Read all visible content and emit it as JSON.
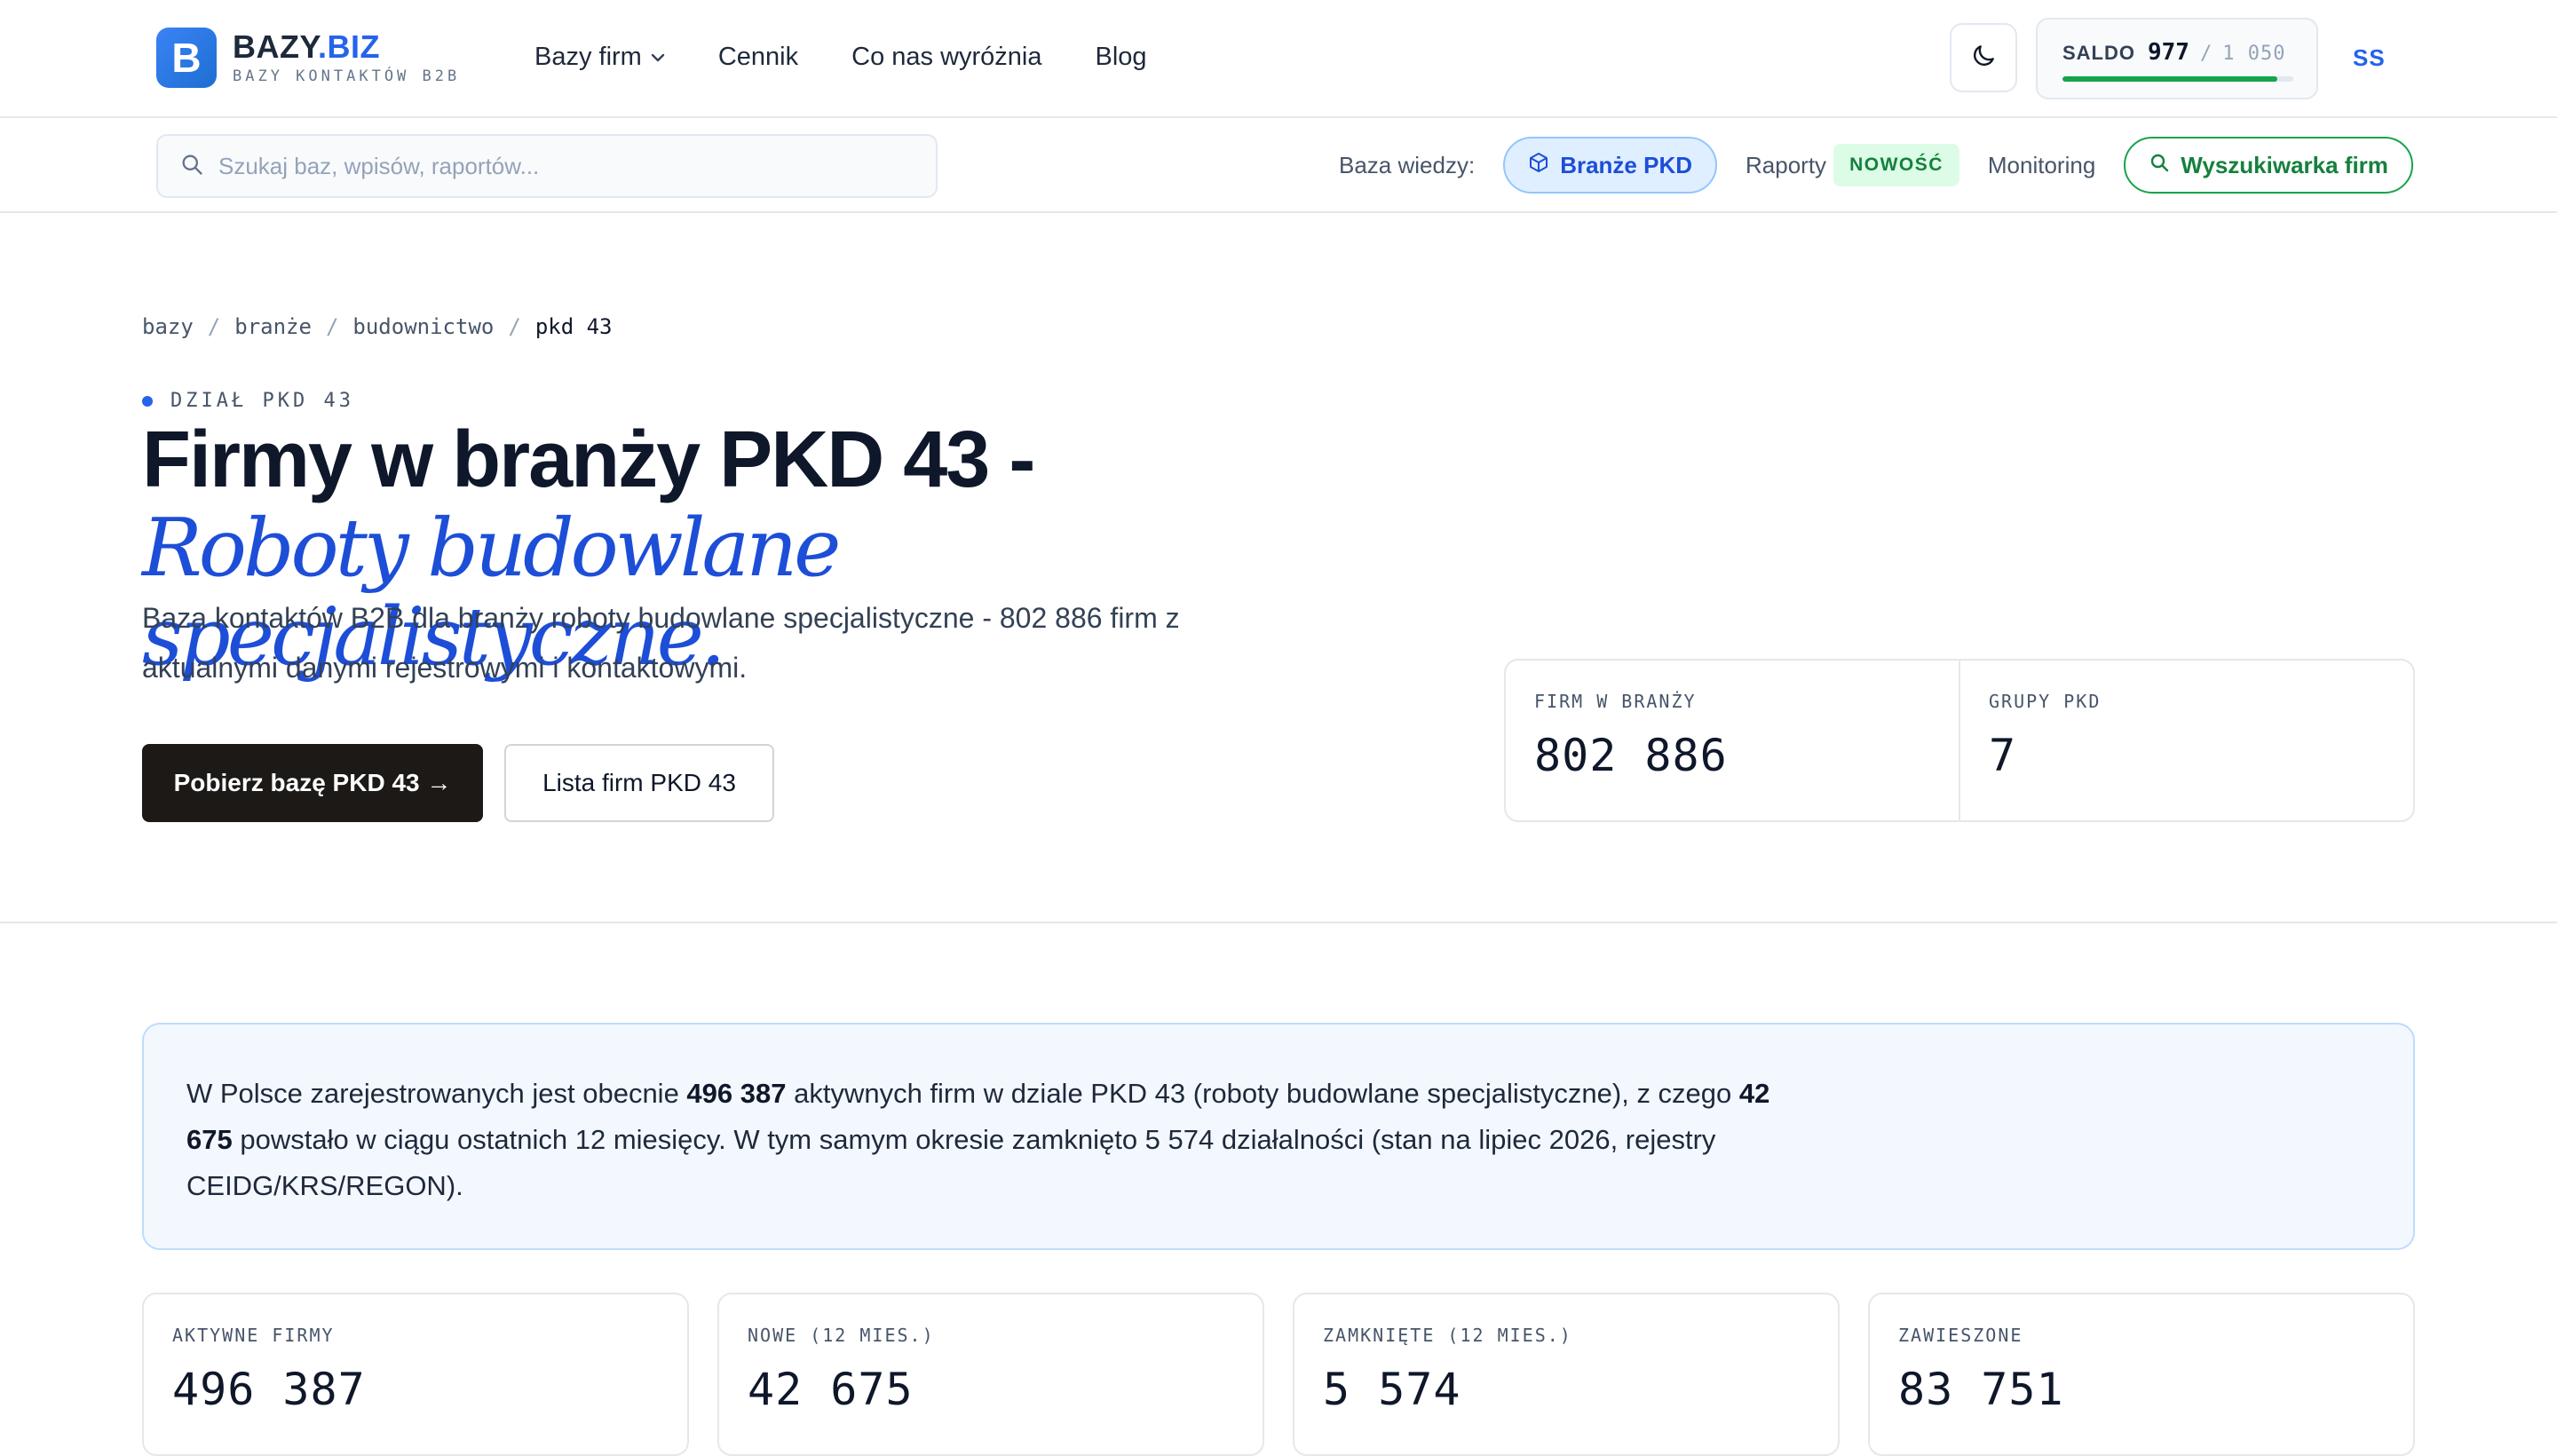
{
  "header": {
    "logo_letter": "B",
    "logo_name_main": "BAZY",
    "logo_name_suffix": ".BIZ",
    "logo_tagline": "BAZY KONTAKTÓW B2B",
    "nav": [
      {
        "label": "Bazy firm",
        "has_dropdown": true
      },
      {
        "label": "Cennik"
      },
      {
        "label": "Co nas wyróżnia"
      },
      {
        "label": "Blog"
      }
    ],
    "theme_icon": "moon-icon",
    "saldo": {
      "label": "SALDO",
      "value": "977",
      "separator": "/",
      "max": "1 050",
      "progress": 0.93
    },
    "user_initials": "SS"
  },
  "subbar": {
    "search_placeholder": "Szukaj baz, wpisów, raportów...",
    "kb_label": "Baza wiedzy:",
    "pkd_link": "Branże PKD",
    "raporty_link": "Raporty",
    "new_badge": "NOWOŚĆ",
    "monitoring_link": "Monitoring",
    "search_button": "Wyszukiwarka firm"
  },
  "breadcrumb": [
    "bazy",
    "branże",
    "budownictwo",
    "pkd 43"
  ],
  "hero": {
    "tag": "DZIAŁ PKD 43",
    "title_main": "Firmy w branży PKD 43 - ",
    "title_accent": "Roboty budowlane specjalistyczne.",
    "description": "Baza kontaktów B2B dla branży roboty budowlane specjalistyczne - 802 886 firm z aktualnymi danymi rejestrowymi i kontaktowymi.",
    "primary_button": "Pobierz bazę PKD 43 →",
    "secondary_button": "Lista firm PKD 43"
  },
  "hero_stats": [
    {
      "label": "FIRM W BRANŻY",
      "value": "802 886"
    },
    {
      "label": "GRUPY PKD",
      "value": "7"
    }
  ],
  "info": {
    "p1": "W Polsce zarejestrowanych jest obecnie ",
    "active": "496 387",
    "p2": " aktywnych firm w dziale PKD 43 (roboty budowlane specjalistyczne), z czego ",
    "new": "42 675",
    "p3": " powstało w ciągu ostatnich 12 miesięcy. W tym samym okresie zamknięto 5 574 działalności (stan na lipiec 2026, rejestry CEIDG/KRS/REGON)."
  },
  "cards": [
    {
      "label": "AKTYWNE FIRMY",
      "value": "496 387"
    },
    {
      "label": "NOWE (12 MIES.)",
      "value": "42 675"
    },
    {
      "label": "ZAMKNIĘTE (12 MIES.)",
      "value": "5 574"
    },
    {
      "label": "ZAWIESZONE",
      "value": "83 751"
    }
  ]
}
